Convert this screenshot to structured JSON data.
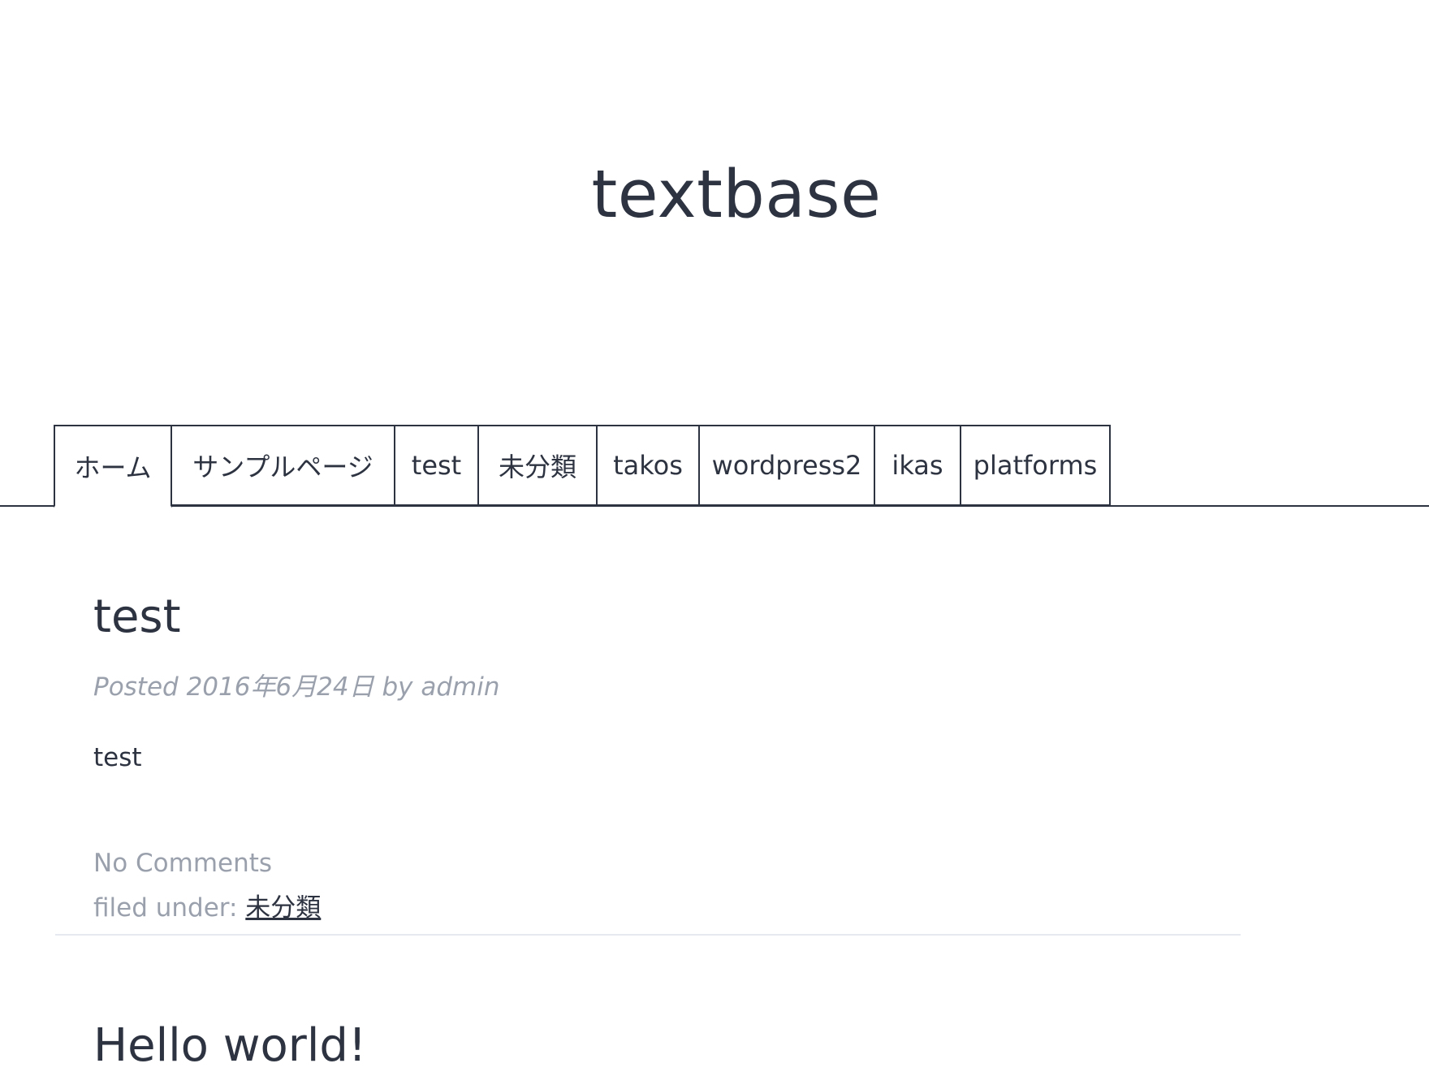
{
  "site": {
    "title": "textbase"
  },
  "nav": {
    "items": [
      {
        "label": "ホーム",
        "active": true
      },
      {
        "label": "サンプルページ",
        "active": false
      },
      {
        "label": "test",
        "active": false
      },
      {
        "label": "未分類",
        "active": false
      },
      {
        "label": "takos",
        "active": false
      },
      {
        "label": "wordpress2",
        "active": false
      },
      {
        "label": "ikas",
        "active": false
      },
      {
        "label": "platforms",
        "active": false
      }
    ]
  },
  "posts": [
    {
      "title": "test",
      "meta": "Posted 2016年6月24日 by admin",
      "body": "test",
      "comments": "No Comments",
      "filed_label": "filed under: ",
      "category": "未分類"
    },
    {
      "title": "Hello world!"
    }
  ],
  "colors": {
    "text": "#2d3340",
    "muted": "#9aa1ad",
    "divider": "#e6e9ef"
  }
}
